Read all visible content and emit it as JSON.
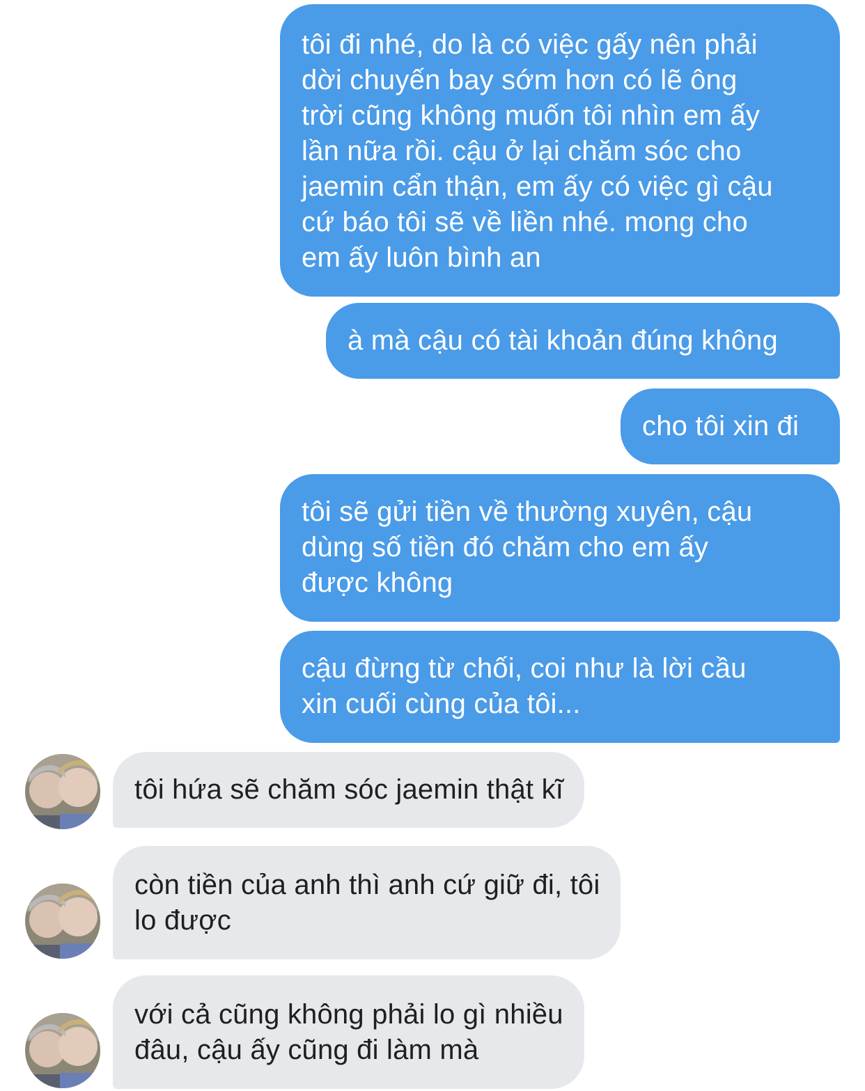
{
  "conversation": {
    "messages": [
      {
        "sender": "me",
        "text": "tôi đi nhé, do là có việc gấy nên phải\ndời chuyến bay sớm hơn có lẽ ông\ntrời cũng không muốn tôi nhìn em ấy\nlần nữa rồi. cậu ở lại chăm sóc cho\njaemin cẩn thận, em ấy có việc gì cậu\ncứ báo tôi sẽ về liền nhé. mong cho\nem ấy luôn bình an"
      },
      {
        "sender": "me",
        "text": "à mà cậu có tài khoản đúng không"
      },
      {
        "sender": "me",
        "text": "cho tôi xin đi"
      },
      {
        "sender": "me",
        "text": "tôi sẽ gửi tiền về thường xuyên, cậu\ndùng số tiền đó chăm cho em ấy\nđược không"
      },
      {
        "sender": "me",
        "text": "cậu đừng từ chối, coi như là lời cầu\nxin cuối cùng của tôi..."
      },
      {
        "sender": "other",
        "text": "tôi hứa sẽ chăm sóc jaemin thật kĩ"
      },
      {
        "sender": "other",
        "text": "còn tiền của anh thì anh cứ giữ đi, tôi\nlo được"
      },
      {
        "sender": "other",
        "text": "với cả cũng không phải lo gì nhiều\nđâu, cậu ấy cũng đi làm mà"
      }
    ]
  },
  "colors": {
    "sent_bubble": "#4a9be8",
    "received_bubble": "#e6e8ec"
  },
  "icons": {
    "avatar": "contact-avatar-photo"
  }
}
